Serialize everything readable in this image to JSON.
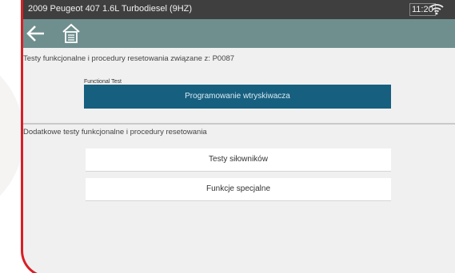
{
  "statusbar": {
    "title": "2009 Peugeot 407 1.6L Turbodiesel (9HZ)",
    "time": "11:20",
    "wifi_icon": "wifi-icon"
  },
  "toolbar": {
    "back_icon": "back-arrow-icon",
    "home_icon": "home-icon",
    "color": "#6f8f8f"
  },
  "main": {
    "related_heading": "Testy funkcjonalne i procedury resetowania związane z:  P0087",
    "functional_caption": "Functional Test",
    "primary_button_label": "Programowanie wtryskiwacza",
    "additional_heading": "Dodatkowe testy funkcjonalne i procedury resetowania",
    "buttons": [
      {
        "label": "Testy siłowników"
      },
      {
        "label": "Funkcje specjalne"
      }
    ]
  },
  "colors": {
    "frame_border": "#d81f26",
    "statusbar_bg": "#3f3f3f",
    "primary_button": "#175f7f",
    "content_bg": "#f0f0f0"
  }
}
